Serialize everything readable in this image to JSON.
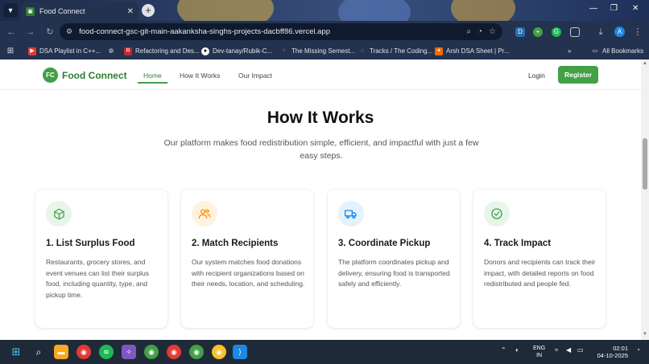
{
  "browser": {
    "tab_title": "Food Connect",
    "url": "food-connect-gsc-git-main-aakanksha-singhs-projects-dacbff86.vercel.app",
    "profile_initial": "A",
    "bookmarks": [
      "DSA Playlist in C++...",
      "Refactoring and Des...",
      "Dev-tanay/Rubik-C...",
      "The Missing Semest...",
      "Tracks / The Coding...",
      "Arsh DSA Sheet | Pr..."
    ],
    "all_bookmarks_label": "All Bookmarks"
  },
  "header": {
    "logo_badge": "FC",
    "logo_text": "Food Connect",
    "nav": [
      "Home",
      "How It Works",
      "Our Impact"
    ],
    "login_label": "Login",
    "register_label": "Register",
    "accent_color": "#43a047"
  },
  "section": {
    "title": "How It Works",
    "subtitle": "Our platform makes food redistribution simple, efficient, and impactful with just a few easy steps."
  },
  "steps": [
    {
      "icon": "package-icon",
      "title": "1. List Surplus Food",
      "description": "Restaurants, grocery stores, and event venues can list their surplus food, including quantity, type, and pickup time.",
      "icon_color": "#43a047",
      "icon_bg": "#e8f5e9"
    },
    {
      "icon": "users-icon",
      "title": "2. Match Recipients",
      "description": "Our system matches food donations with recipient organizations based on their needs, location, and scheduling.",
      "icon_color": "#fb8c00",
      "icon_bg": "#fff3e0"
    },
    {
      "icon": "truck-icon",
      "title": "3. Coordinate Pickup",
      "description": "The platform coordinates pickup and delivery, ensuring food is transported safely and efficiently.",
      "icon_color": "#1e88e5",
      "icon_bg": "#e3f2fd"
    },
    {
      "icon": "check-circle-icon",
      "title": "4. Track Impact",
      "description": "Donors and recipients can track their impact, with detailed reports on food redistributed and people fed.",
      "icon_color": "#43a047",
      "icon_bg": "#e8f5e9"
    }
  ],
  "taskbar": {
    "lang_line1": "ENG",
    "lang_line2": "IN",
    "time": "02:01",
    "date": "04-10-2025"
  }
}
